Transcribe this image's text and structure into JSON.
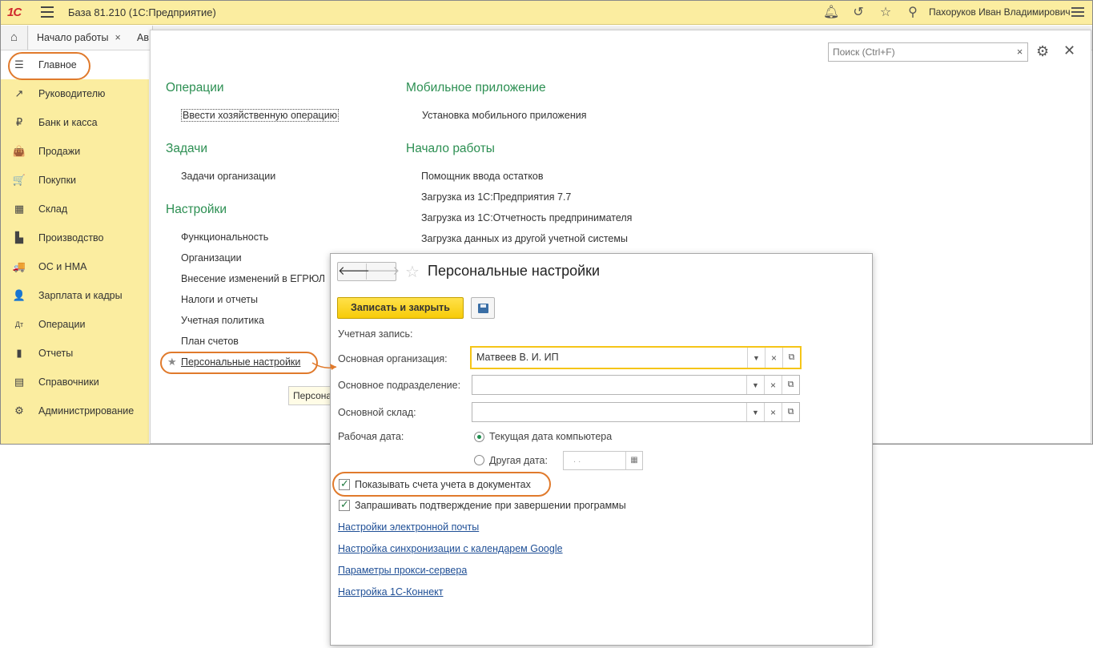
{
  "titlebar": {
    "logo": "1С",
    "title": "База 81.210  (1С:Предприятие)",
    "user": "Пахоруков Иван Владимирович",
    "icons": [
      "bell-icon",
      "history-icon",
      "star-icon",
      "search-icon",
      "menu-icon"
    ]
  },
  "tabs": [
    {
      "label": "Начало работы",
      "close": "×"
    },
    {
      "label": "Ав"
    }
  ],
  "sidebar": {
    "items": [
      {
        "label": "Главное",
        "icon": "☰"
      },
      {
        "label": "Руководителю",
        "icon": "↗"
      },
      {
        "label": "Банк и касса",
        "icon": "₽"
      },
      {
        "label": "Продажи",
        "icon": "👜"
      },
      {
        "label": "Покупки",
        "icon": "🛒"
      },
      {
        "label": "Склад",
        "icon": "▦"
      },
      {
        "label": "Производство",
        "icon": "▙"
      },
      {
        "label": "ОС и НМА",
        "icon": "🚚"
      },
      {
        "label": "Зарплата и кадры",
        "icon": "👤"
      },
      {
        "label": "Операции",
        "icon": "Дт"
      },
      {
        "label": "Отчеты",
        "icon": "▮"
      },
      {
        "label": "Справочники",
        "icon": "▤"
      },
      {
        "label": "Администрирование",
        "icon": "⚙"
      }
    ]
  },
  "search": {
    "placeholder": "Поиск (Ctrl+F)",
    "clear": "×"
  },
  "sections": {
    "operations": {
      "title": "Операции",
      "links": [
        "Ввести хозяйственную операцию"
      ]
    },
    "tasks": {
      "title": "Задачи",
      "links": [
        "Задачи организации"
      ]
    },
    "settings": {
      "title": "Настройки",
      "links": [
        "Функциональность",
        "Организации",
        "Внесение изменений в ЕГРЮЛ",
        "Налоги и отчеты",
        "Учетная политика",
        "План счетов",
        "Персональные настройки"
      ]
    },
    "mobile": {
      "title": "Мобильное приложение",
      "links": [
        "Установка мобильного приложения"
      ]
    },
    "start": {
      "title": "Начало работы",
      "links": [
        "Помощник ввода остатков",
        "Загрузка из 1С:Предприятия 7.7",
        "Загрузка из 1С:Отчетность предпринимателя",
        "Загрузка данных из другой учетной системы"
      ]
    },
    "tooltip": "Персона"
  },
  "dialog": {
    "title": "Персональные настройки",
    "save_close": "Записать и закрыть",
    "account_label": "Учетная запись:",
    "org_label": "Основная организация:",
    "org_value": "Матвеев В. И. ИП",
    "division_label": "Основное подразделение:",
    "warehouse_label": "Основной склад:",
    "workdate_label": "Рабочая дата:",
    "radio_current": "Текущая дата компьютера",
    "radio_other": "Другая дата:",
    "date_value": ".  .",
    "chk_show_accounts": "Показывать счета учета в документах",
    "chk_confirm_exit": "Запрашивать подтверждение при завершении программы",
    "links": [
      "Настройки электронной почты",
      "Настройка синхронизации с календарем Google",
      "Параметры прокси-сервера",
      "Настройка 1С-Коннект"
    ]
  },
  "colors": {
    "accent_yellow": "#fbeda0",
    "section_green": "#2c8f52",
    "highlight_orange": "#e07a2c",
    "link_blue": "#1f4f96"
  }
}
